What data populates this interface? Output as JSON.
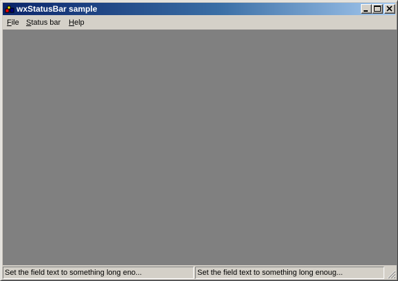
{
  "window": {
    "title": "wxStatusBar sample",
    "icon": "app-icon",
    "controls": [
      "minimize-icon",
      "maximize-icon",
      "close-icon"
    ]
  },
  "menu": {
    "items": [
      {
        "label": "File",
        "mnemonic": "F"
      },
      {
        "label": "Status bar",
        "mnemonic": "S"
      },
      {
        "label": "Help",
        "mnemonic": "H"
      }
    ]
  },
  "client": {
    "background": "#808080"
  },
  "statusbar": {
    "fields": [
      "Set the field text to something long eno...",
      "Set the field text to something long enoug..."
    ]
  },
  "colors": {
    "title_start": "#0a246a",
    "title_end": "#a6caf0",
    "face": "#d4d0c8"
  }
}
